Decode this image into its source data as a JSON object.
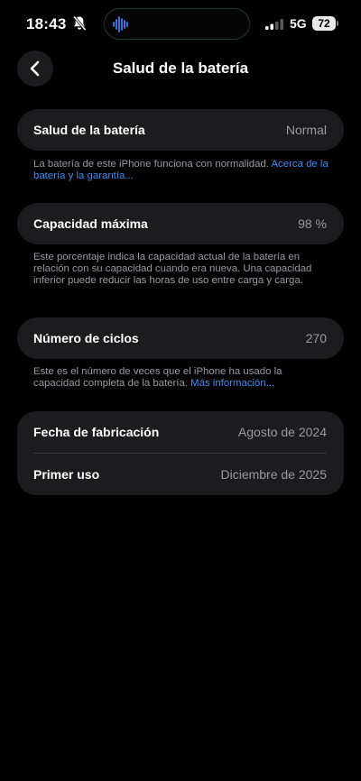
{
  "status_bar": {
    "time": "18:43",
    "network": "5G",
    "battery_level": "72",
    "icons": [
      "bell-slash-icon",
      "waveform-icon",
      "signal-icon"
    ]
  },
  "header": {
    "back_icon": "chevron-left-icon",
    "title": "Salud de la batería"
  },
  "health": {
    "label": "Salud de la batería",
    "value": "Normal",
    "note": "La batería de este iPhone funciona con normalidad.",
    "link": "Acerca de la batería y la garantía..."
  },
  "capacity": {
    "label": "Capacidad máxima",
    "value": "98 %",
    "note": "Este porcentaje indica la capacidad actual de la batería en relación con su capacidad cuando era nueva. Una capacidad inferior puede reducir las horas de uso entre carga y carga."
  },
  "cycles": {
    "label": "Número de ciclos",
    "value": "270",
    "note": "Este es el número de veces que el iPhone ha usado la capacidad completa de la batería.",
    "link": "Más información..."
  },
  "dates": {
    "manufacture_label": "Fecha de fabricación",
    "manufacture_value": "Agosto de 2024",
    "first_use_label": "Primer uso",
    "first_use_value": "Diciembre de 2025"
  },
  "colors": {
    "background": "#000000",
    "card": "#1c1c1e",
    "secondary_text": "#9a9a9f",
    "link": "#3a8bf4",
    "island_border": "#1d3b25",
    "waveform": "#3f7cf3"
  }
}
